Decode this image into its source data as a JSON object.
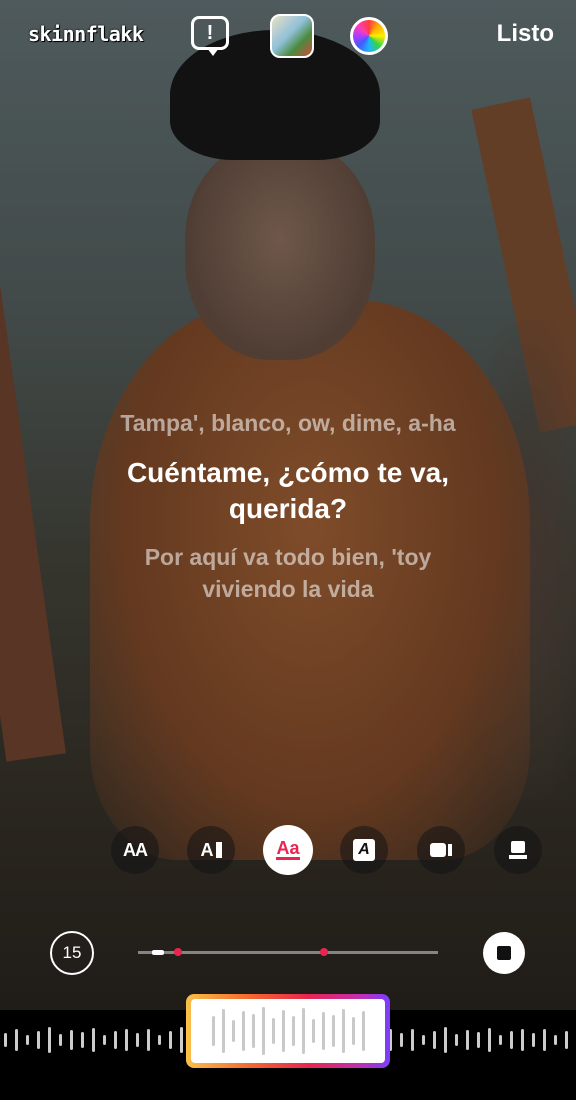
{
  "header": {
    "username": "skinnflakk",
    "done_label": "Listo"
  },
  "lyrics": {
    "previous": "Tampa', blanco, ow, dime, a-ha",
    "current_line1": "Cuéntame, ¿cómo te va,",
    "current_line2": "querida?",
    "next_line1": "Por aquí va todo bien, 'toy",
    "next_line2": "viviendo la vida"
  },
  "style_options": [
    {
      "label": "AA"
    },
    {
      "label": "A"
    },
    {
      "label": "Aa"
    },
    {
      "label": "A"
    },
    {
      "label": ""
    },
    {
      "label": ""
    }
  ],
  "timeline": {
    "duration": "15"
  },
  "colors": {
    "accent": "#e8254f"
  }
}
